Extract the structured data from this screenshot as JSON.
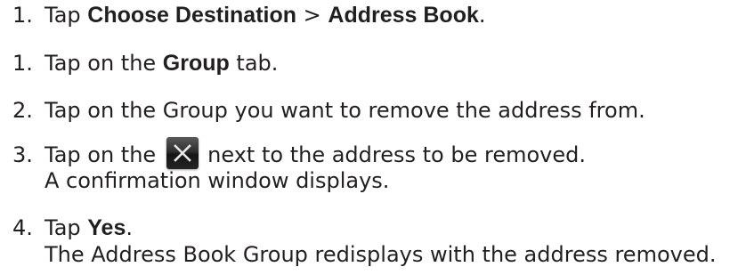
{
  "steps": [
    {
      "number": "1.",
      "prefix": "Tap ",
      "bold1": "Choose Destination",
      "sep": " > ",
      "bold2": "Address Book",
      "suffix": "."
    },
    {
      "number": "1.",
      "prefix": "Tap on the ",
      "bold": "Group",
      "suffix": " tab."
    },
    {
      "number": "2.",
      "text": "Tap on the Group you want to remove the address from."
    },
    {
      "number": "3.",
      "prefix": "Tap on the",
      "icon": "close-x-icon",
      "suffix": "next to the address to be removed.",
      "subtext": "A confirmation window displays."
    },
    {
      "number": "4.",
      "prefix": "Tap ",
      "bold": "Yes",
      "suffix": ".",
      "subtext": "The Address Book Group redisplays with the address removed."
    }
  ]
}
